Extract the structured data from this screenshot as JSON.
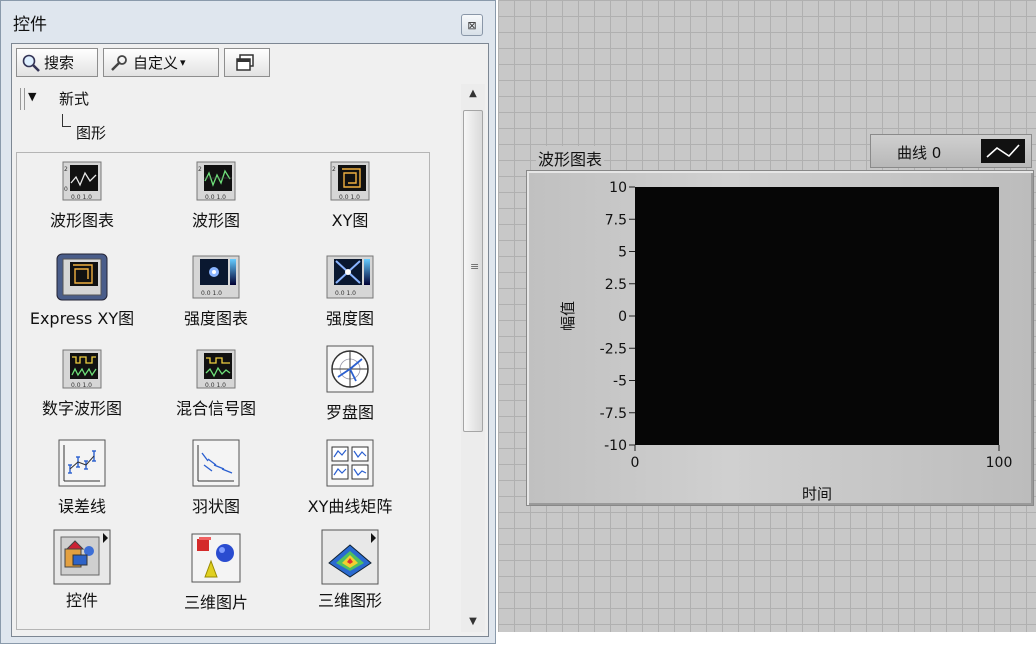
{
  "palette": {
    "title": "控件",
    "close_glyph": "⊠",
    "toolbar": {
      "search_label": "搜索",
      "custom_label": "自定义",
      "custom_arrow": "▾"
    },
    "tree": {
      "root": "新式",
      "child": "图形"
    },
    "scroll_grip": "≡",
    "items": [
      {
        "label": "波形图表",
        "icon": "waveform-chart-icon"
      },
      {
        "label": "波形图",
        "icon": "waveform-graph-icon"
      },
      {
        "label": "XY图",
        "icon": "xy-graph-icon"
      },
      {
        "label": "Express XY图",
        "icon": "express-xy-graph-icon"
      },
      {
        "label": "强度图表",
        "icon": "intensity-chart-icon"
      },
      {
        "label": "强度图",
        "icon": "intensity-graph-icon"
      },
      {
        "label": "数字波形图",
        "icon": "digital-waveform-icon"
      },
      {
        "label": "混合信号图",
        "icon": "mixed-signal-icon"
      },
      {
        "label": "罗盘图",
        "icon": "compass-plot-icon"
      },
      {
        "label": "误差线",
        "icon": "error-bar-icon"
      },
      {
        "label": "羽状图",
        "icon": "feather-plot-icon"
      },
      {
        "label": "XY曲线矩阵",
        "icon": "xy-plot-matrix-icon"
      },
      {
        "label": "控件",
        "icon": "controls-subpalette-icon"
      },
      {
        "label": "三维图片",
        "icon": "3d-picture-icon"
      },
      {
        "label": "三维图形",
        "icon": "3d-graph-icon"
      }
    ]
  },
  "chart": {
    "label": "波形图表",
    "legend_text": "曲线 0",
    "colors": {
      "plot_bg": "#060606",
      "frame": "#c4c4c4",
      "trace_icon": "#ffffff"
    }
  },
  "chart_data": {
    "type": "line",
    "title": "",
    "xlabel": "时间",
    "ylabel": "幅值",
    "xlim": [
      0,
      100
    ],
    "ylim": [
      -10,
      10
    ],
    "x_ticks": [
      "0",
      "100"
    ],
    "y_ticks": [
      "10",
      "7.5",
      "5",
      "2.5",
      "0",
      "-2.5",
      "-5",
      "-7.5",
      "-10"
    ],
    "series": [
      {
        "name": "曲线 0",
        "values": []
      }
    ],
    "grid": false,
    "legend_position": "top-right"
  }
}
